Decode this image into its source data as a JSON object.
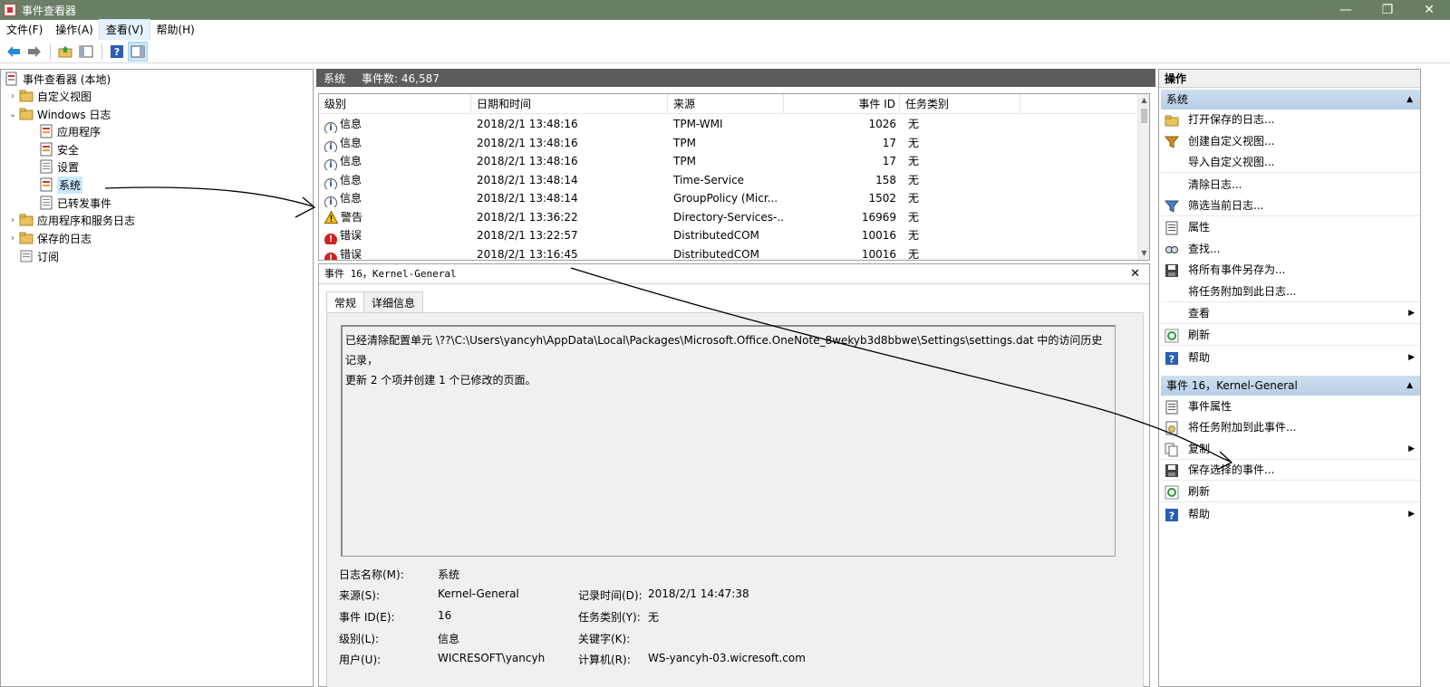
{
  "window": {
    "title": "事件查看器",
    "min": "—",
    "max": "❐",
    "close": "✕"
  },
  "menu": [
    "文件(F)",
    "操作(A)",
    "查看(V)",
    "帮助(H)"
  ],
  "tree": {
    "root": "事件查看器 (本地)",
    "custom_views": "自定义视图",
    "windows_logs": "Windows 日志",
    "application": "应用程序",
    "security": "安全",
    "setup": "设置",
    "system": "系统",
    "forwarded": "已转发事件",
    "app_service_logs": "应用程序和服务日志",
    "saved_logs": "保存的日志",
    "subscriptions": "订阅"
  },
  "center": {
    "log_name": "系统",
    "event_count": "事件数: 46,587",
    "columns": [
      "级别",
      "日期和时间",
      "来源",
      "事件 ID",
      "任务类别"
    ],
    "rows": [
      {
        "level": "信息",
        "type": "info",
        "datetime": "2018/2/1 13:48:16",
        "source": "TPM-WMI",
        "id": "1026",
        "task": "无"
      },
      {
        "level": "信息",
        "type": "info",
        "datetime": "2018/2/1 13:48:16",
        "source": "TPM",
        "id": "17",
        "task": "无"
      },
      {
        "level": "信息",
        "type": "info",
        "datetime": "2018/2/1 13:48:16",
        "source": "TPM",
        "id": "17",
        "task": "无"
      },
      {
        "level": "信息",
        "type": "info",
        "datetime": "2018/2/1 13:48:14",
        "source": "Time-Service",
        "id": "158",
        "task": "无"
      },
      {
        "level": "信息",
        "type": "info",
        "datetime": "2018/2/1 13:48:14",
        "source": "GroupPolicy (Micr...",
        "id": "1502",
        "task": "无"
      },
      {
        "level": "警告",
        "type": "warn",
        "datetime": "2018/2/1 13:36:22",
        "source": "Directory-Services-...",
        "id": "16969",
        "task": "无"
      },
      {
        "level": "错误",
        "type": "error",
        "datetime": "2018/2/1 13:22:57",
        "source": "DistributedCOM",
        "id": "10016",
        "task": "无"
      },
      {
        "level": "错误",
        "type": "error",
        "datetime": "2018/2/1 13:16:45",
        "source": "DistributedCOM",
        "id": "10016",
        "task": "无"
      }
    ]
  },
  "detail": {
    "title": "事件 16，Kernel-General",
    "close": "✕",
    "tabs": [
      "常规",
      "详细信息"
    ],
    "message_line1": "已经清除配置单元 \\??\\C:\\Users\\yancyh\\AppData\\Local\\Packages\\Microsoft.Office.OneNote_8wekyb3d8bbwe\\Settings\\settings.dat 中的访问历史记录，",
    "message_line2": "更新 2 个项并创建 1 个已修改的页面。",
    "log_name_label": "日志名称(M):",
    "log_name_value": "系统",
    "source_label": "来源(S):",
    "source_value": "Kernel-General",
    "logged_label": "记录时间(D):",
    "logged_value": "2018/2/1 14:47:38",
    "event_id_label": "事件 ID(E):",
    "event_id_value": "16",
    "task_label": "任务类别(Y):",
    "task_value": "无",
    "level_label": "级别(L):",
    "level_value": "信息",
    "keywords_label": "关键字(K):",
    "keywords_value": "",
    "user_label": "用户(U):",
    "user_value": "WICRESOFT\\yancyh",
    "computer_label": "计算机(R):",
    "computer_value": "WS-yancyh-03.wicresoft.com"
  },
  "actions": {
    "header": "操作",
    "section1": "系统",
    "items1": [
      "打开保存的日志...",
      "创建自定义视图...",
      "导入自定义视图...",
      "清除日志...",
      "筛选当前日志...",
      "属性",
      "查找...",
      "将所有事件另存为...",
      "将任务附加到此日志...",
      "查看",
      "刷新",
      "帮助"
    ],
    "section2": "事件 16，Kernel-General",
    "items2": [
      "事件属性",
      "将任务附加到此事件...",
      "复制",
      "保存选择的事件...",
      "刷新",
      "帮助"
    ]
  },
  "colors": {
    "titlebar": "#6b7f67",
    "section": "#c3d6ec",
    "selected": "#cce8ff"
  }
}
